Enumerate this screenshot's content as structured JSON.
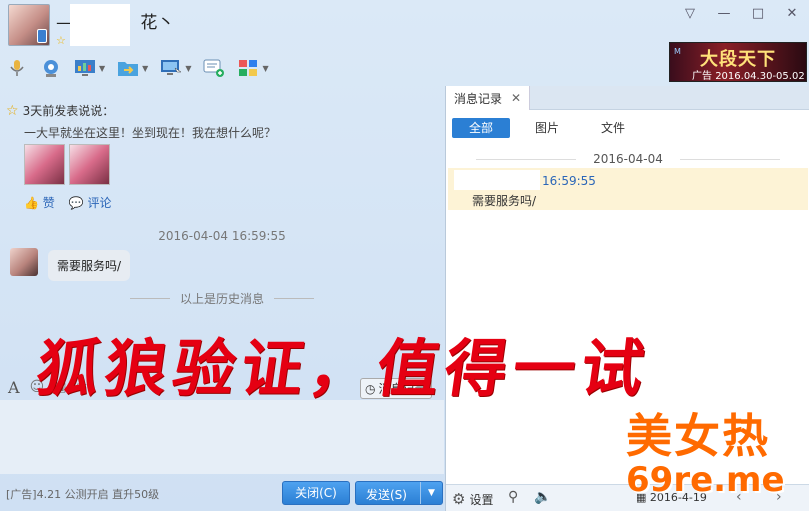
{
  "title": {
    "nickname": "—",
    "nickname_suffix": "花丶"
  },
  "window_controls": {
    "menu": "▽",
    "minimize": "—",
    "maximize": "□",
    "close": "✕"
  },
  "toolbar": {
    "icons": [
      "microphone-icon",
      "video-icon",
      "screen-share-icon",
      "file-transfer-icon",
      "remote-desktop-icon",
      "new-message-icon",
      "apps-icon"
    ]
  },
  "ad_top": {
    "label": "广告",
    "title": "大段天下",
    "dates": "2016.04.30-05.02"
  },
  "feed": {
    "header": "3天前发表说说：",
    "text": "一大早就坐在这里！坐到现在！我在想什么呢？",
    "like": "赞",
    "comment": "评论"
  },
  "chat": {
    "timestamp": "2016-04-04 16:59:55",
    "message": "需要服务吗/",
    "history_divider": "以上是历史消息"
  },
  "input": {
    "font_icon": "A",
    "message_record_button": "消息记录"
  },
  "bottom": {
    "ad_text": "[广告]4.21 公测开启 直升50级",
    "close_button": "关闭(C)",
    "send_button": "发送(S)"
  },
  "record": {
    "tab_label": "消息记录",
    "filters": [
      "全部",
      "图片",
      "文件"
    ],
    "date": "2016-04-04",
    "item_time": "16:59:55",
    "item_message": "需要服务吗/",
    "settings": "设置",
    "footer_date": "2016-4-19"
  },
  "overlay": {
    "watermark": "狐狼验证，值得一试",
    "brand_line1": "美女热",
    "brand_line2": "69re.me"
  },
  "colors": {
    "accent": "#2b7fd4",
    "watermark": "#e50012",
    "brand": "#ff6a00"
  }
}
